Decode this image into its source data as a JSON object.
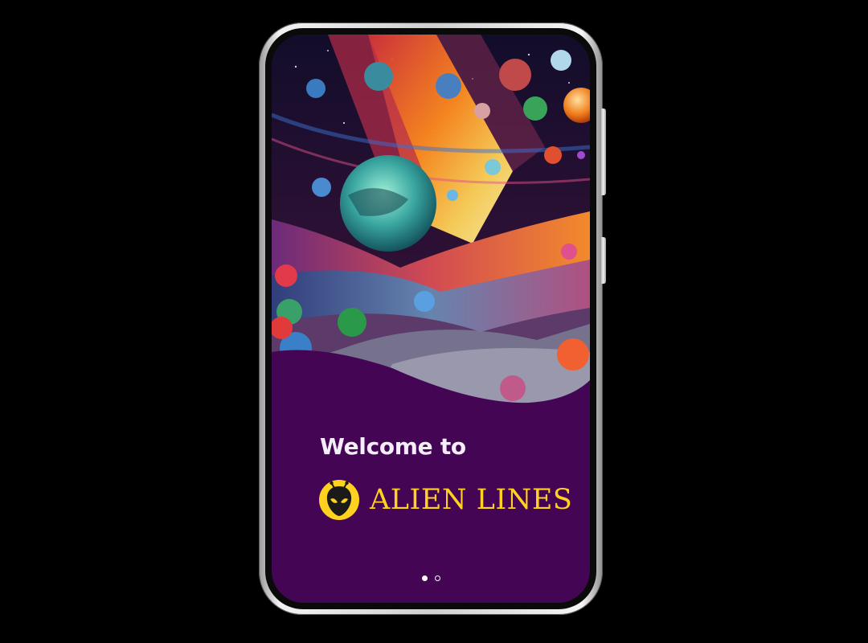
{
  "onboarding": {
    "welcome_text": "Welcome to",
    "brand_name": "ALIEN LINES",
    "logo_icon": "alien-head-icon",
    "page_indicator": {
      "total_pages": 2,
      "current_page": 1
    }
  },
  "colors": {
    "background": "#000000",
    "screen_background": "#440654",
    "brand_yellow": "#ffd21f",
    "welcome_text": "#f5eefa",
    "dot_color": "#ffffff"
  }
}
